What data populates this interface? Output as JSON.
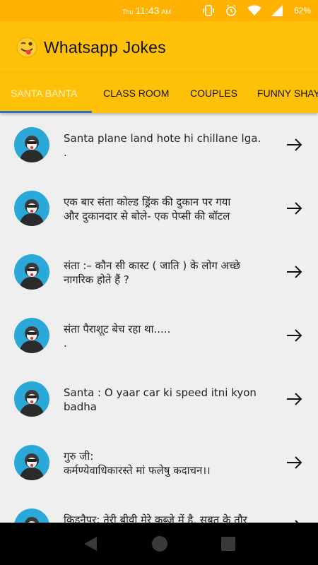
{
  "status": {
    "day": "Thu",
    "time": "11:43",
    "ampm": "AM",
    "battery": "62%"
  },
  "app": {
    "title": "Whatsapp Jokes",
    "logo_icon": "winking-tongue-emoji-icon"
  },
  "tabs": [
    {
      "label": "SANTA BANTA",
      "active": true
    },
    {
      "label": "CLASS ROOM",
      "active": false
    },
    {
      "label": "COUPLES",
      "active": false
    },
    {
      "label": "FUNNY SHAYARI",
      "active": false
    }
  ],
  "jokes": [
    {
      "line1": "Santa plane land hote hi chillane lga.",
      "line2": "."
    },
    {
      "line1": "एक बार संता कोल्ड ड्रिंक की दुकान पर गया",
      "line2": "और दुकानदार से बोले- एक पेप्सी की बॉटल"
    },
    {
      "line1": "संता :– कौन सी कास्ट ( जाति ) के लोग अच्छे",
      "line2": "नागरिक होते हैं ?"
    },
    {
      "line1": "संता पैराशूट बेच रहा था.....",
      "line2": "."
    },
    {
      "line1": "Santa : O yaar car ki speed itni kyon",
      "line2": "badha"
    },
    {
      "line1": "गुरु जी:",
      "line2": "कर्मण्येवाधिकारस्ते मां फलेषु कदाचन।।"
    },
    {
      "line1": "किडनैपर: तेरी बीवी मेरे कब्जे में है, सबूत के तौर",
      "line2": ""
    }
  ],
  "colors": {
    "status_bar": "#ffb300",
    "app_bar": "#ffc107",
    "tab_indicator": "#2f6fbd",
    "avatar_bg": "#2aa8d8",
    "list_bg": "#efefef"
  }
}
